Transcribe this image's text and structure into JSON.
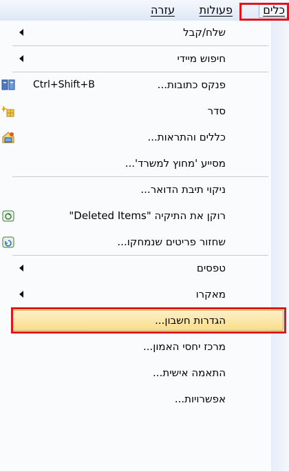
{
  "menubar": {
    "items": [
      {
        "label": "כלים",
        "active": true
      },
      {
        "label": "פעולות"
      },
      {
        "label": "עזרה"
      }
    ]
  },
  "menu": {
    "items": [
      {
        "label": "שלח/קבל",
        "submenu": true
      },
      {
        "label": "חיפוש מיידי",
        "submenu": true
      },
      {
        "label": "פנקס כתובות...",
        "shortcut": "Ctrl+Shift+B",
        "icon": "address-book-icon"
      },
      {
        "label": "סדר",
        "icon": "organize-icon"
      },
      {
        "label": "כללים והתראות...",
        "icon": "rules-alerts-icon"
      },
      {
        "label": "מסייע 'מחוץ למשרד'..."
      },
      {
        "label": "ניקוי תיבת הדואר..."
      },
      {
        "label": "רוקן את התיקיה \"Deleted Items\"",
        "icon": "empty-trash-icon"
      },
      {
        "label": "שחזור פריטים שנמחקו...",
        "icon": "recover-items-icon"
      },
      {
        "label": "טפסים",
        "submenu": true
      },
      {
        "label": "מאקרו",
        "submenu": true
      },
      {
        "label": "הגדרות חשבון...",
        "highlighted": true
      },
      {
        "label": "מרכז יחסי האמון..."
      },
      {
        "label": "התאמה אישית..."
      },
      {
        "label": "אפשרויות..."
      }
    ]
  },
  "colors": {
    "highlight_border": "#e0141d",
    "hover_fill": "#f8dd8a"
  }
}
